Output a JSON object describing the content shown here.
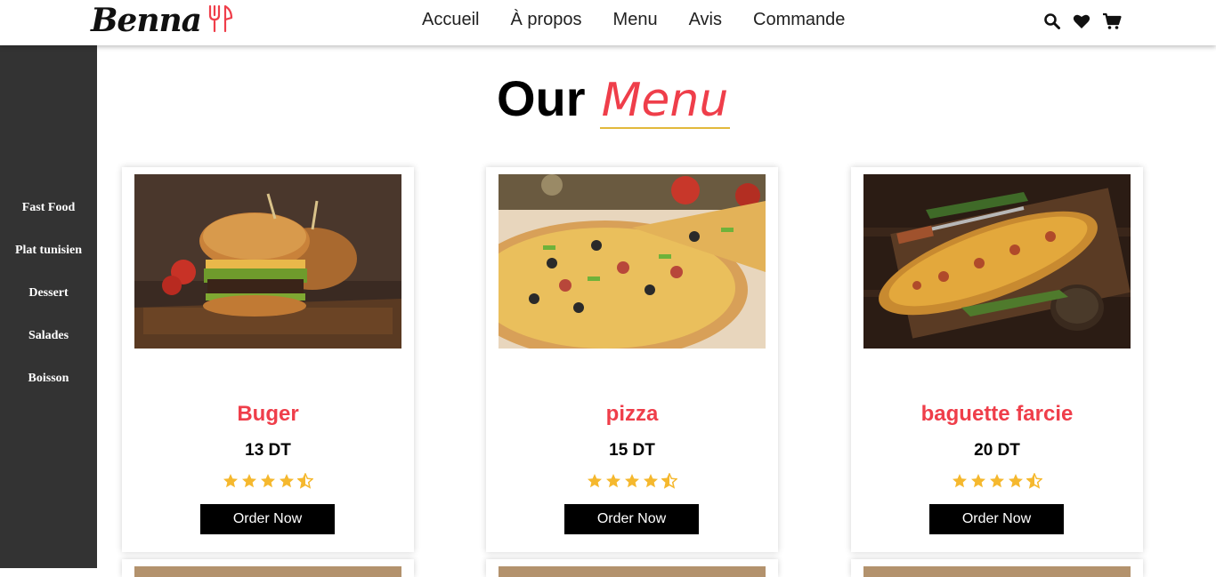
{
  "brand": {
    "name": "Benna",
    "icon": "fork-knife-icon",
    "accent": "#ef3e4a"
  },
  "nav": {
    "links": [
      "Accueil",
      "À propos",
      "Menu",
      "Avis",
      "Commande"
    ],
    "icons": [
      "search-icon",
      "heart-icon",
      "cart-icon"
    ]
  },
  "sidebar": {
    "items": [
      "Fast Food",
      "Plat tunisien",
      "Dessert",
      "Salades",
      "Boisson"
    ]
  },
  "heading": {
    "our": "Our",
    "menu": "Menu",
    "underline_color": "#e2b93b"
  },
  "menu_items": [
    {
      "name": "Buger",
      "price": "13 DT",
      "rating": 4.5,
      "button": "Order Now",
      "image": "burger-photo"
    },
    {
      "name": "pizza",
      "price": "15 DT",
      "rating": 4.5,
      "button": "Order Now",
      "image": "pizza-photo"
    },
    {
      "name": "baguette farcie",
      "price": "20 DT",
      "rating": 4.5,
      "button": "Order Now",
      "image": "baguette-photo"
    }
  ],
  "colors": {
    "sidebar": "#333333",
    "star": "#f5b82e",
    "button": "#000000"
  }
}
